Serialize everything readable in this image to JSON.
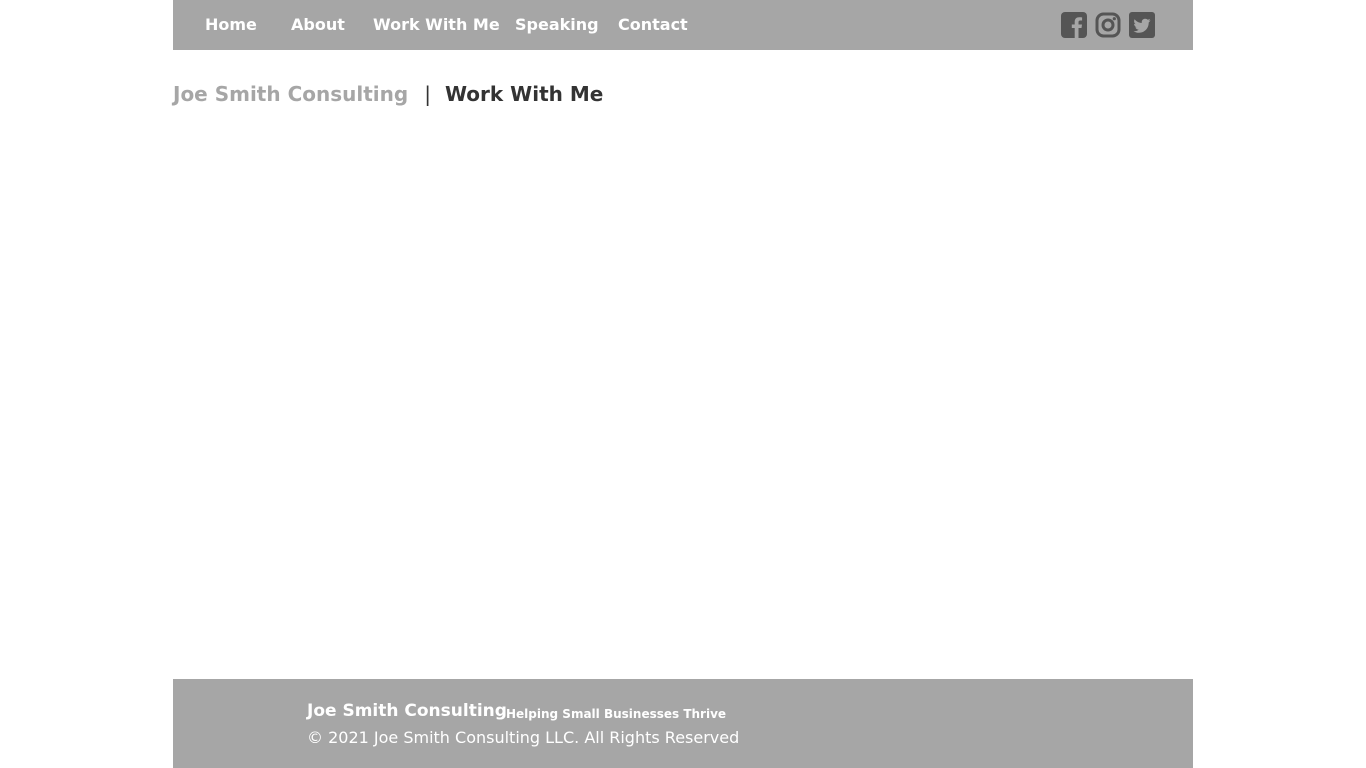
{
  "nav": {
    "items": [
      {
        "label": "Home"
      },
      {
        "label": "About"
      },
      {
        "label": "Work With Me"
      },
      {
        "label": "Speaking"
      },
      {
        "label": "Contact"
      }
    ],
    "social_icons": [
      "facebook-icon",
      "instagram-icon",
      "twitter-icon"
    ],
    "icon_color": "#555555"
  },
  "breadcrumb": {
    "site": "Joe Smith Consulting",
    "separator": "|",
    "current": "Work With Me"
  },
  "footer": {
    "brand": "Joe Smith Consulting",
    "tagline": "Helping Small Businesses Thrive",
    "copyright": "© 2021 Joe Smith Consulting LLC. All Rights Reserved"
  },
  "colors": {
    "bar_background": "#a6a6a6",
    "bar_text": "#ffffff",
    "heading_text": "#333333",
    "muted_text": "#a6a6a6"
  }
}
